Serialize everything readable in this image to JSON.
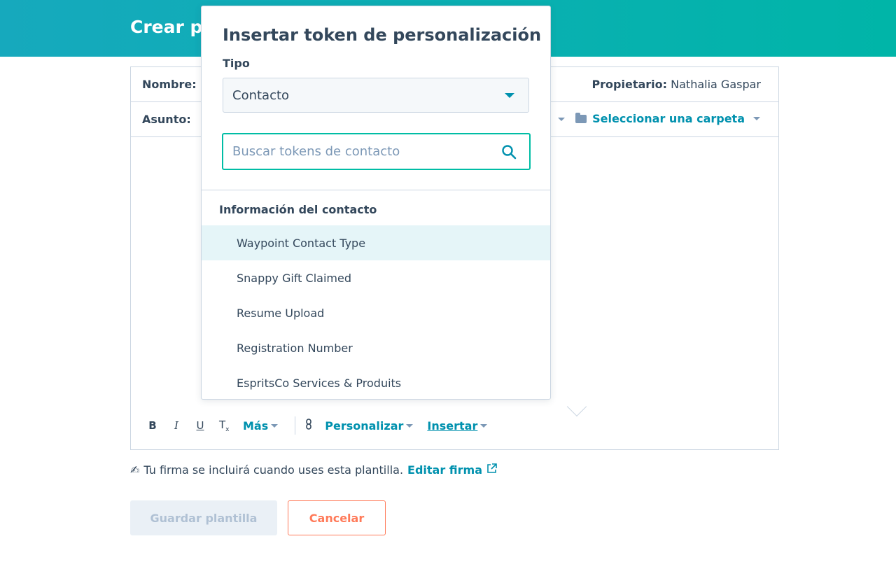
{
  "header": {
    "title": "Crear pl"
  },
  "form": {
    "name_label": "Nombre:",
    "owner_label": "Propietario:",
    "owner_value": "Nathalia Gaspar",
    "subject_label": "Asunto:",
    "folder_label": "Seleccionar una carpeta"
  },
  "toolbar": {
    "bold": "B",
    "italic": "I",
    "underline": "U",
    "clear_format": "T",
    "more_label": "Más",
    "personalize_label": "Personalizar",
    "insert_label": "Insertar"
  },
  "signature": {
    "text": "Tu firma se incluirá cuando uses esta plantilla.",
    "edit_link": "Editar firma"
  },
  "buttons": {
    "save_label": "Guardar plantilla",
    "cancel_label": "Cancelar"
  },
  "popover": {
    "title": "Insertar token de personalización",
    "type_label": "Tipo",
    "type_value": "Contacto",
    "search_placeholder": "Buscar tokens de contacto",
    "group_heading": "Información del contacto",
    "items": [
      "Waypoint Contact Type",
      "Snappy Gift Claimed",
      "Resume Upload",
      "Registration Number",
      "EspritsCo Services & Produits"
    ]
  },
  "colors": {
    "accent": "#0091ae",
    "header_start": "#16a9bd",
    "header_end": "#00b5a8",
    "cancel_orange": "#ff7a59",
    "search_border": "#00bda5"
  }
}
